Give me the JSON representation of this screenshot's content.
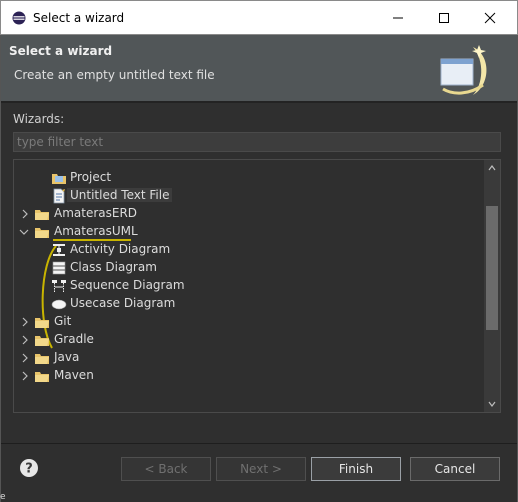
{
  "window": {
    "title": "Select a wizard",
    "controls": {
      "minimize": "minimize-icon",
      "maximize": "maximize-icon",
      "close": "close-icon"
    }
  },
  "header": {
    "title": "Select a wizard",
    "description": "Create an empty untitled text file"
  },
  "wizards_label": "Wizards:",
  "filter": {
    "placeholder": "type filter text",
    "value": ""
  },
  "tree": {
    "items": [
      {
        "label": "Project",
        "icon": "project-icon",
        "depth": 1,
        "expander": "none"
      },
      {
        "label": "Untitled Text File",
        "icon": "text-file-icon",
        "depth": 1,
        "expander": "none",
        "selected": true
      },
      {
        "label": "AmaterasERD",
        "icon": "folder-icon",
        "depth": 0,
        "expander": "collapsed"
      },
      {
        "label": "AmaterasUML",
        "icon": "folder-icon",
        "depth": 0,
        "expander": "expanded"
      },
      {
        "label": "Activity Diagram",
        "icon": "activity-diagram-icon",
        "depth": 1,
        "expander": "none"
      },
      {
        "label": "Class Diagram",
        "icon": "class-diagram-icon",
        "depth": 1,
        "expander": "none"
      },
      {
        "label": "Sequence Diagram",
        "icon": "sequence-diagram-icon",
        "depth": 1,
        "expander": "none"
      },
      {
        "label": "Usecase Diagram",
        "icon": "usecase-diagram-icon",
        "depth": 1,
        "expander": "none"
      },
      {
        "label": "Git",
        "icon": "folder-icon",
        "depth": 0,
        "expander": "collapsed"
      },
      {
        "label": "Gradle",
        "icon": "folder-icon",
        "depth": 0,
        "expander": "collapsed"
      },
      {
        "label": "Java",
        "icon": "folder-icon",
        "depth": 0,
        "expander": "collapsed"
      },
      {
        "label": "Maven",
        "icon": "folder-icon",
        "depth": 0,
        "expander": "collapsed"
      }
    ]
  },
  "buttons": {
    "back": "< Back",
    "next": "Next >",
    "finish": "Finish",
    "cancel": "Cancel"
  },
  "edge_glyph": "e",
  "colors": {
    "header_bg": "#515658",
    "dialog_bg": "#2f2f2f",
    "annotation": "#c8b400",
    "text": "#dcdcdc"
  }
}
